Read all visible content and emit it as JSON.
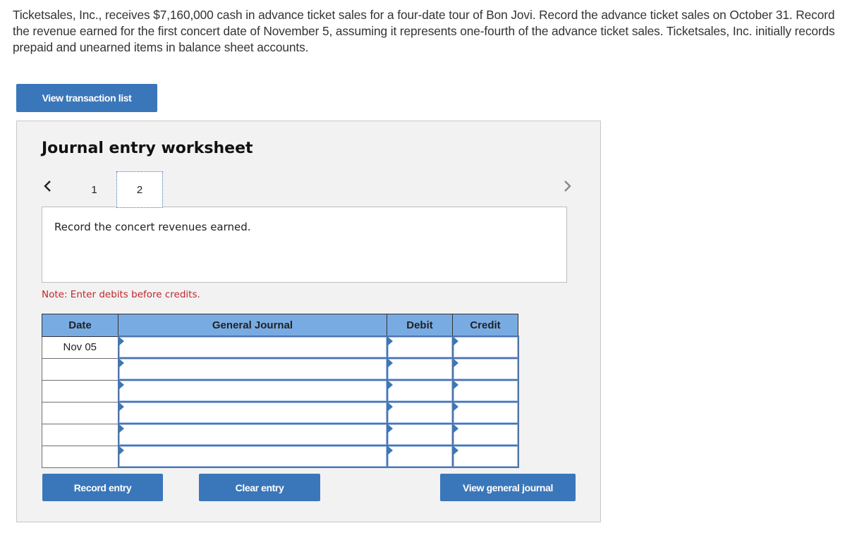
{
  "problem": {
    "text": "Ticketsales, Inc., receives $7,160,000 cash in advance ticket sales for a four-date tour of Bon Jovi. Record the advance ticket sales on October 31. Record the revenue earned for the first concert date of November 5, assuming it represents one-fourth of the advance ticket sales. Ticketsales, Inc. initially records prepaid and unearned items in balance sheet accounts."
  },
  "buttons": {
    "view_transaction_list": "View transaction list",
    "record_entry": "Record entry",
    "clear_entry": "Clear entry",
    "view_general_journal": "View general journal"
  },
  "worksheet": {
    "title": "Journal entry worksheet",
    "tabs": [
      {
        "label": "1",
        "active": false
      },
      {
        "label": "2",
        "active": true
      }
    ],
    "prev_icon": "chevron-left-icon",
    "next_icon": "chevron-right-icon",
    "description": "Record the concert revenues earned.",
    "note": "Note: Enter debits before credits.",
    "colors": {
      "accent": "#3a77ba",
      "header_bg": "#79abe3",
      "note": "#c0262d",
      "panel_bg": "#f2f2f2"
    }
  },
  "journal": {
    "columns": [
      "Date",
      "General Journal",
      "Debit",
      "Credit"
    ],
    "rows": [
      {
        "date": "Nov 05",
        "account": "",
        "debit": "",
        "credit": ""
      },
      {
        "date": "",
        "account": "",
        "debit": "",
        "credit": ""
      },
      {
        "date": "",
        "account": "",
        "debit": "",
        "credit": ""
      },
      {
        "date": "",
        "account": "",
        "debit": "",
        "credit": ""
      },
      {
        "date": "",
        "account": "",
        "debit": "",
        "credit": ""
      },
      {
        "date": "",
        "account": "",
        "debit": "",
        "credit": ""
      }
    ]
  }
}
